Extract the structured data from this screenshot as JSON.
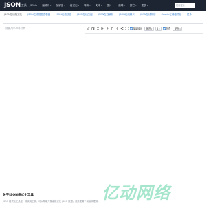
{
  "header": {
    "logo_mark": "JSON",
    "logo_sub": "工具",
    "nav": [
      {
        "label": "JSON",
        "has_caret": true
      },
      {
        "label": "编解码",
        "has_caret": true
      },
      {
        "label": "加解密",
        "has_caret": true
      },
      {
        "label": "格式化",
        "has_caret": true
      },
      {
        "label": "转换",
        "has_caret": true
      },
      {
        "label": "文本",
        "has_caret": true
      },
      {
        "label": "图片",
        "has_caret": true
      },
      {
        "label": "前端",
        "has_caret": true
      },
      {
        "label": "其它",
        "has_caret": true
      },
      {
        "label": "更多",
        "has_caret": true
      }
    ],
    "search_placeholder": "站内搜索"
  },
  "subnav": {
    "items": [
      {
        "label": "JSON在线格式化",
        "active": true
      },
      {
        "label": "JSON在线视图查看器",
        "active": false
      },
      {
        "label": "JSON在线校验",
        "active": false
      },
      {
        "label": "JSON在线压缩",
        "active": false
      },
      {
        "label": "JSON在线解析",
        "active": false
      },
      {
        "label": "JSON在线转义",
        "active": false
      },
      {
        "label": "JSON在线排序",
        "active": false
      },
      {
        "label": "Cookie在线格式化",
        "active": false
      },
      {
        "label": "更多",
        "active": false
      }
    ]
  },
  "editor": {
    "left_placeholder": "请输入JSON字符串"
  },
  "toolbar": {
    "icons": [
      "edit-icon",
      "copy-icon",
      "collapse-icon",
      "expand-icon",
      "download-icon",
      "delete-icon",
      "upload-icon",
      "share-icon",
      "fullscreen-icon"
    ],
    "checkbox1_label": "保留转义",
    "select1_value": "缩进",
    "select2_value": "4",
    "checkbox2_label": "折叠",
    "select3_value": "配色"
  },
  "about": {
    "title": "关于JSON格式化工具",
    "text": "JSON 格式化工具是一种实用工具，可以帮助开发者格式化 JSON 数据，使其更易于阅读和理解。"
  },
  "watermark": {
    "text": "亿动网络"
  }
}
